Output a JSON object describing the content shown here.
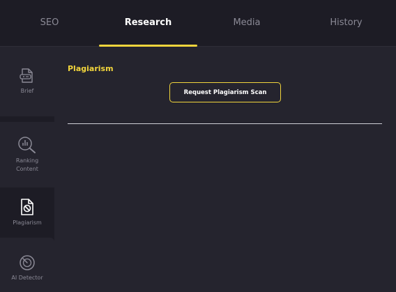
{
  "tabs": [
    {
      "label": "SEO",
      "active": false
    },
    {
      "label": "Research",
      "active": true
    },
    {
      "label": "Media",
      "active": false
    },
    {
      "label": "History",
      "active": false
    }
  ],
  "sidebar": {
    "items": [
      {
        "label": "Brief",
        "icon": "brief-icon",
        "active": false
      },
      {
        "label": "Ranking Content",
        "icon": "ranking-content-icon",
        "active": false
      },
      {
        "label": "Plagiarism",
        "icon": "plagiarism-icon",
        "active": true
      },
      {
        "label": "AI Detector",
        "icon": "ai-detector-icon",
        "active": false
      }
    ]
  },
  "main": {
    "section_title": "Plagiarism",
    "scan_button_label": "Request Plagiarism Scan"
  },
  "colors": {
    "accent": "#f2d53c",
    "background": "#1d1c25",
    "panel": "#25242e",
    "text_muted": "#8b8a96"
  }
}
